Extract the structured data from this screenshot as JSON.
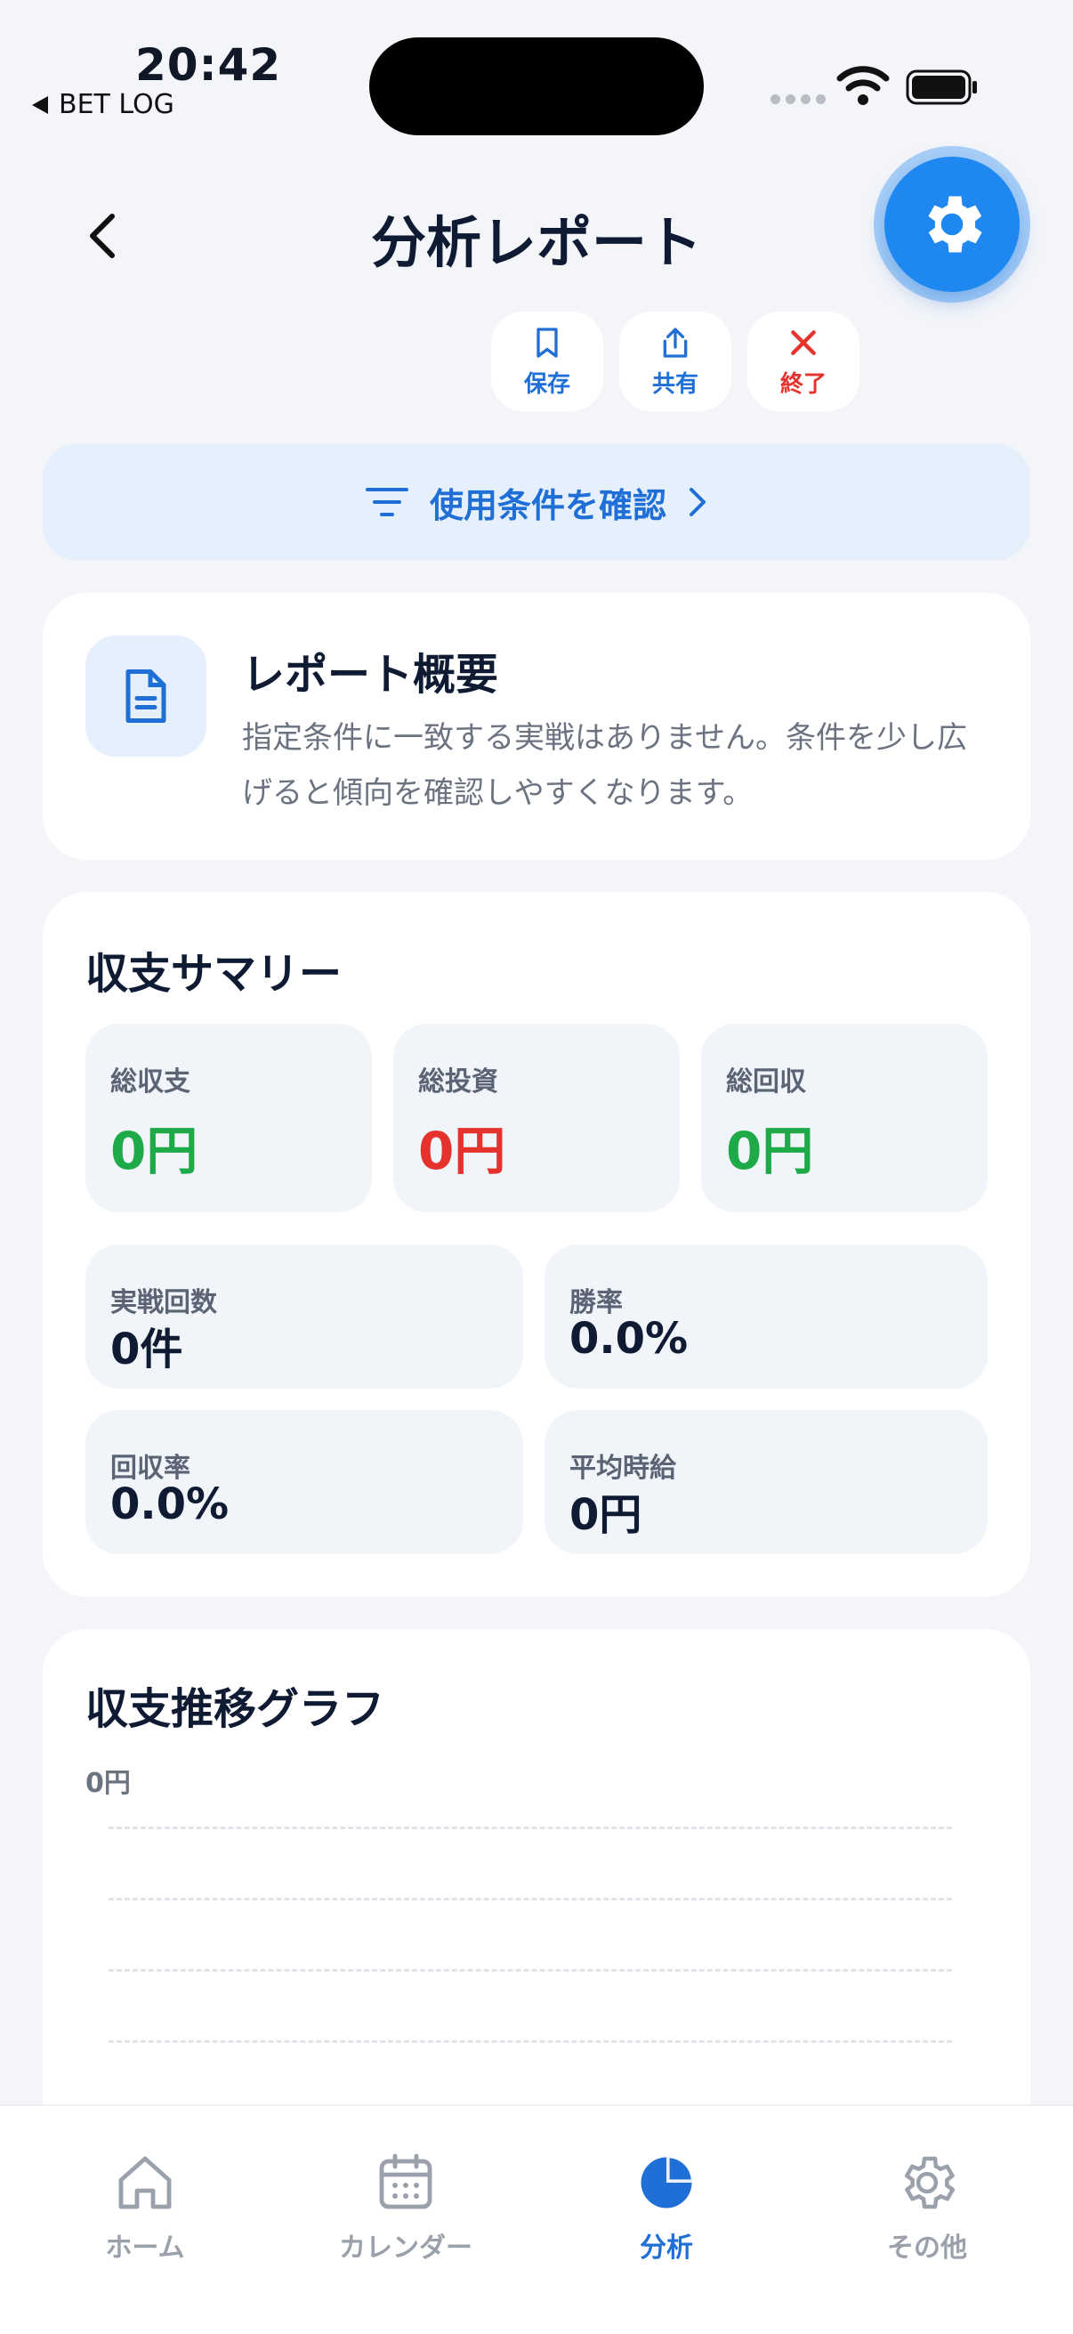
{
  "status_bar": {
    "time": "20:42",
    "back_app": "BET LOG"
  },
  "header": {
    "title": "分析レポート"
  },
  "actions": [
    {
      "label": "保存",
      "icon": "bookmark-icon"
    },
    {
      "label": "共有",
      "icon": "share-icon"
    },
    {
      "label": "終了",
      "icon": "close-icon"
    }
  ],
  "conditions": {
    "label": "使用条件を確認"
  },
  "report_summary": {
    "title": "レポート概要",
    "text": "指定条件に一致する実戦はありません。条件を少し広げると傾向を確認しやすくなります。"
  },
  "balance_summary": {
    "title": "収支サマリー",
    "top_stats": [
      {
        "label": "総収支",
        "value": "0円"
      },
      {
        "label": "総投資",
        "value": "0円"
      },
      {
        "label": "総回収",
        "value": "0円"
      }
    ],
    "stats": [
      {
        "label": "実戦回数",
        "value": "0件"
      },
      {
        "label": "勝率",
        "value": "0.0%"
      },
      {
        "label": "回収率",
        "value": "0.0%"
      },
      {
        "label": "平均時給",
        "value": "0円"
      }
    ]
  },
  "chart": {
    "title": "収支推移グラフ",
    "ylabel": "0円"
  },
  "tabbar": [
    {
      "label": "ホーム",
      "icon": "home-icon"
    },
    {
      "label": "カレンダー",
      "icon": "calendar-icon"
    },
    {
      "label": "分析",
      "icon": "pie-chart-icon"
    },
    {
      "label": "その他",
      "icon": "gear-icon"
    }
  ],
  "colors": {
    "accent": "#1f6fd6",
    "positive": "#1faa4a",
    "negative": "#e5322d",
    "background": "#f3f5f9"
  }
}
